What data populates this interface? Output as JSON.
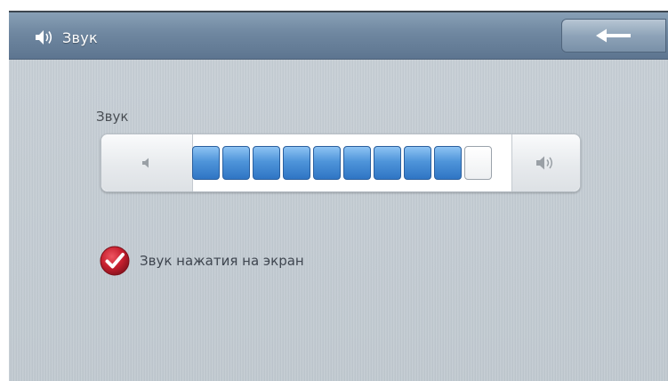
{
  "header": {
    "title": "Звук",
    "speaker_icon": "speaker-icon",
    "back_icon": "back-arrow-icon"
  },
  "volume": {
    "label": "Звук",
    "level": 9,
    "max": 10,
    "down_icon": "volume-down-icon",
    "up_icon": "volume-up-icon"
  },
  "touch_sound": {
    "label": "Звук нажатия на экран",
    "checked": true,
    "icon": "checkmark-icon"
  },
  "colors": {
    "header": "#6f87a0",
    "segment_on": "#4f95da",
    "check": "#c0202e"
  }
}
